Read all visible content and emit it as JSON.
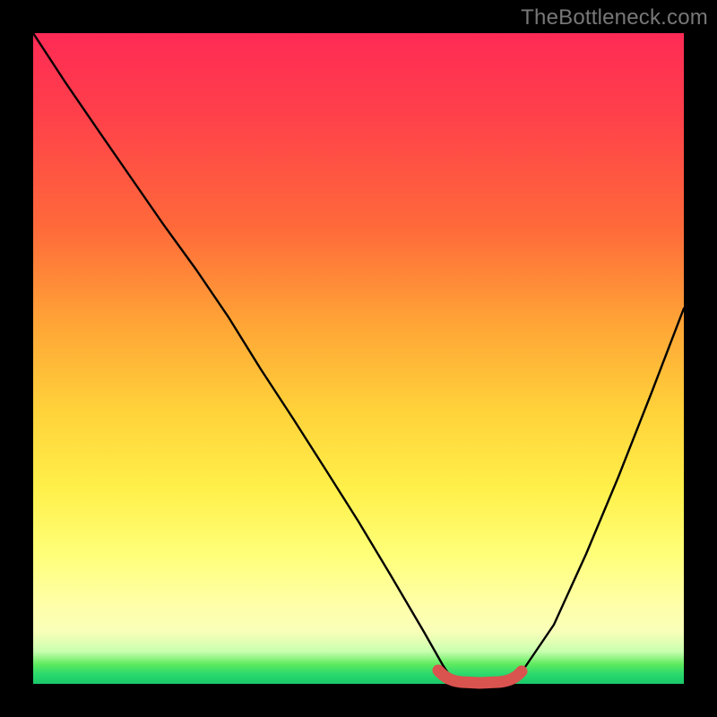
{
  "watermark": "TheBottleneck.com",
  "colors": {
    "background": "#000000",
    "curve_stroke": "#000000",
    "valley_highlight": "#d9534f"
  },
  "chart_data": {
    "type": "line",
    "title": "",
    "xlabel": "",
    "ylabel": "",
    "xlim": [
      0,
      100
    ],
    "ylim": [
      0,
      100
    ],
    "grid": false,
    "series": [
      {
        "name": "bottleneck-curve",
        "x": [
          0,
          5,
          10,
          15,
          20,
          25,
          30,
          35,
          40,
          45,
          50,
          55,
          60,
          63,
          65,
          68,
          70,
          72,
          75,
          80,
          85,
          90,
          95,
          100
        ],
        "values": [
          100,
          93,
          85,
          78,
          71,
          64,
          56,
          48,
          41,
          33,
          25,
          17,
          8,
          3,
          1,
          0,
          0,
          0,
          2,
          9,
          20,
          32,
          45,
          58
        ]
      }
    ],
    "annotations": [
      {
        "name": "valley-highlight",
        "x_start": 62,
        "x_end": 74,
        "style": "thick-rounded",
        "color": "#d9534f"
      }
    ]
  }
}
